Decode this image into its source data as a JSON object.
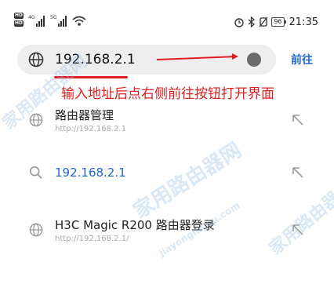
{
  "status_bar": {
    "left": {
      "sim1": "HD",
      "sim2": "HD",
      "net1": "4G",
      "net2": "5G"
    },
    "right": {
      "battery": "96",
      "time": "21:35"
    },
    "icons": [
      "alarm-icon",
      "bluetooth-icon",
      "mute-icon",
      "battery-icon",
      "hd-icon",
      "wifi-icon"
    ]
  },
  "address_bar": {
    "value": "192.168.2.1",
    "go_label": "前往"
  },
  "annotation": {
    "text": "输入地址后点右侧前往按钮打开界面",
    "color": "#e02020"
  },
  "suggestions": [
    {
      "title": "路由器管理",
      "subtitle": "http://192.168.2.1",
      "icon": "globe-icon"
    },
    {
      "title": "192.168.2.1",
      "subtitle": "",
      "icon": "search-icon"
    },
    {
      "title": "H3C Magic R200 路由器登录",
      "subtitle": "http://192.168.2.1/",
      "icon": "globe-icon"
    }
  ],
  "watermark": {
    "text": "家用路由器网",
    "url": "jiayongluyou.com"
  },
  "colors": {
    "accent": "#1e66d0",
    "annotation": "#e02020",
    "bar_bg": "#eeeeee"
  }
}
